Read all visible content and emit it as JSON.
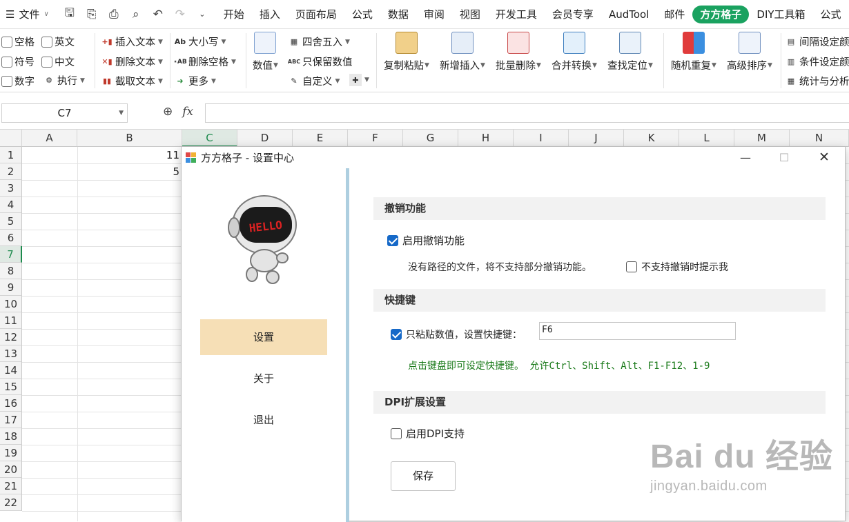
{
  "menubar": {
    "file_label": "文件",
    "tabs": [
      "开始",
      "插入",
      "页面布局",
      "公式",
      "数据",
      "审阅",
      "视图",
      "开发工具",
      "会员专享",
      "AudTool",
      "邮件",
      "方方格子",
      "DIY工具箱",
      "公式"
    ],
    "active_tab": "方方格子"
  },
  "ribbon": {
    "checks": [
      "空格",
      "英文",
      "符号",
      "中文",
      "数字"
    ],
    "exec_label": "执行",
    "text_ops": [
      "插入文本",
      "删除文本",
      "截取文本"
    ],
    "case_ops": [
      "大小写",
      "删除空格",
      "更多"
    ],
    "number_label": "数值",
    "round_label": "四舍五入",
    "keep_value_label": "只保留数值",
    "custom_label": "自定义",
    "big_buttons": [
      "复制粘贴",
      "新增插入",
      "批量删除",
      "合并转换",
      "查找定位",
      "随机重复",
      "高级排序"
    ],
    "right_items": [
      "间隔设定颜",
      "条件设定颜",
      "统计与分析"
    ]
  },
  "formula_bar": {
    "name_box": "C7",
    "fx_label": "fx"
  },
  "grid": {
    "columns": [
      "A",
      "B",
      "C",
      "D",
      "E",
      "F",
      "G",
      "H",
      "I",
      "J",
      "K",
      "L",
      "M",
      "N"
    ],
    "selected_column": "C",
    "rows": [
      "1",
      "2",
      "3",
      "4",
      "5",
      "6",
      "7",
      "8",
      "9",
      "10",
      "11",
      "12",
      "13",
      "14",
      "15",
      "16",
      "17",
      "18",
      "19",
      "20",
      "21",
      "22"
    ],
    "selected_row": "7",
    "cells": {
      "B1": "11",
      "B2": "5"
    }
  },
  "dialog": {
    "title": "方方格子 - 设置中心",
    "nav": [
      "设置",
      "关于",
      "退出"
    ],
    "active_nav": "设置",
    "sections": {
      "undo": {
        "header": "撤销功能",
        "enable_label": "启用撤销功能",
        "enable_checked": true,
        "note": "没有路径的文件，将不支持部分撤销功能。",
        "prompt_label": "不支持撤销时提示我",
        "prompt_checked": false
      },
      "shortcut": {
        "header": "快捷键",
        "paste_label": "只粘贴数值，设置快捷键：",
        "paste_checked": true,
        "hotkey_value": "F6",
        "hint": "点击键盘即可设定快捷键。  允许Ctrl、Shift、Alt、F1-F12、1-9"
      },
      "dpi": {
        "header": "DPI扩展设置",
        "enable_label": "启用DPI支持",
        "enable_checked": false
      }
    },
    "save_label": "保存",
    "mascot_text": "HELLO"
  },
  "watermark": {
    "brand": "Bai du 经验",
    "url": "jingyan.baidu.com"
  },
  "colors": {
    "accent_green": "#1aa260",
    "nav_active": "#f6dfb6",
    "checkbox_blue": "#1669c8",
    "hint_green": "#1a7a1a",
    "divider_blue": "#aecfe0"
  }
}
